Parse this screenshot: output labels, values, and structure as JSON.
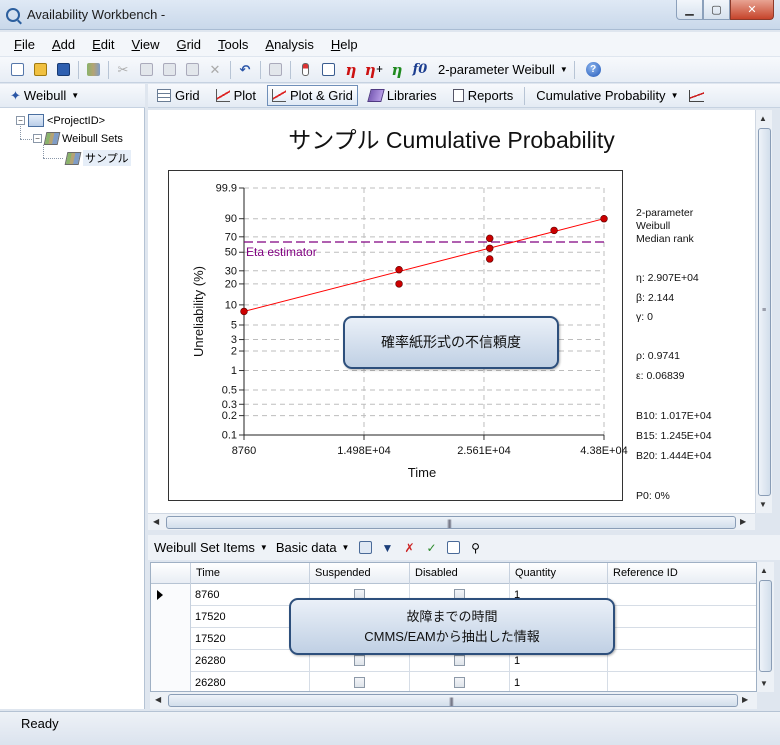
{
  "window": {
    "title": "Availability Workbench -"
  },
  "menu": [
    "File",
    "Add",
    "Edit",
    "View",
    "Grid",
    "Tools",
    "Analysis",
    "Help"
  ],
  "toolbar": {
    "distribution": "2-parameter Weibull"
  },
  "left_panel": {
    "header": "Weibull",
    "tree": {
      "project": "<ProjectID>",
      "sets": "Weibull Sets",
      "sample": "サンプル"
    }
  },
  "tabs": {
    "grid": "Grid",
    "plot": "Plot",
    "plot_grid": "Plot & Grid",
    "libraries": "Libraries",
    "reports": "Reports",
    "plot_type": "Cumulative Probability"
  },
  "chart_data": {
    "type": "scatter",
    "title": "サンプル Cumulative Probability",
    "xlabel": "Time",
    "ylabel": "Unreliability (%)",
    "x_tick_labels": [
      "8760",
      "1.498E+04",
      "2.561E+04",
      "4.38E+04"
    ],
    "y_ticks": [
      0.1,
      0.2,
      0.3,
      0.5,
      1,
      2,
      3,
      5,
      10,
      20,
      30,
      50,
      70,
      90,
      99.9
    ],
    "y_tick_labels": [
      "0.1",
      "0.2",
      "0.3",
      "0.5",
      "1",
      "2",
      "3",
      "5",
      "10",
      "20",
      "30",
      "50",
      "70",
      "90",
      "99.9"
    ],
    "xlim": [
      8760,
      43800
    ],
    "ylim": [
      0.1,
      99.9
    ],
    "points": [
      {
        "x": 8760,
        "y": 8
      },
      {
        "x": 17520,
        "y": 20
      },
      {
        "x": 17520,
        "y": 31
      },
      {
        "x": 26280,
        "y": 42
      },
      {
        "x": 26280,
        "y": 55
      },
      {
        "x": 26280,
        "y": 68
      },
      {
        "x": 35040,
        "y": 78
      },
      {
        "x": 43800,
        "y": 90
      }
    ],
    "fit_line": [
      {
        "x": 8760,
        "y": 8
      },
      {
        "x": 43800,
        "y": 90
      }
    ],
    "reference_line": {
      "y": 63.2,
      "label": "Eta estimator"
    },
    "colors": {
      "points": "#cc0000",
      "fit": "#ff0000",
      "reference": "#800080"
    }
  },
  "results": {
    "model": "2-parameter",
    "dist": "Weibull",
    "rank": "Median rank",
    "eta": "η: 2.907E+04",
    "beta": "β: 2.144",
    "gamma": "γ: 0",
    "rho": "ρ: 0.9741",
    "eps": "ε: 0.06839",
    "b10": "B10: 1.017E+04",
    "b15": "B15: 1.245E+04",
    "b20": "B20: 1.444E+04",
    "p0": "P0: 0%"
  },
  "callouts": {
    "chart": "確率紙形式の不信頼度",
    "grid_line1": "故障までの時間",
    "grid_line2": "CMMS/EAMから抽出した情報"
  },
  "items_bar": {
    "items_menu": "Weibull Set Items",
    "data_menu": "Basic data"
  },
  "grid": {
    "columns": [
      "Time",
      "Suspended",
      "Disabled",
      "Quantity",
      "Reference ID"
    ],
    "rows": [
      {
        "time": "8760",
        "quantity": "1"
      },
      {
        "time": "17520",
        "quantity": ""
      },
      {
        "time": "17520",
        "quantity": ""
      },
      {
        "time": "26280",
        "quantity": "1"
      },
      {
        "time": "26280",
        "quantity": "1"
      }
    ]
  },
  "status": "Ready"
}
